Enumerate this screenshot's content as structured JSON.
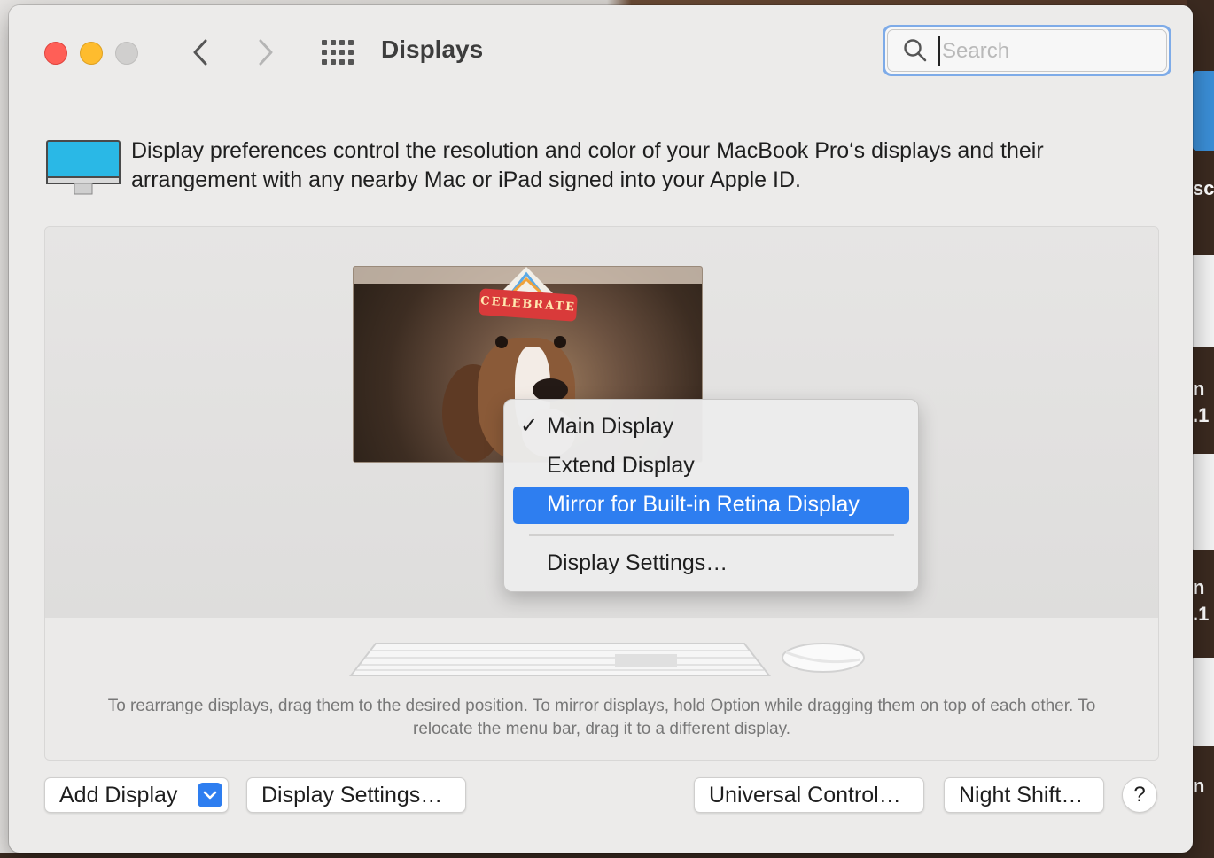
{
  "window": {
    "title": "Displays"
  },
  "toolbar": {
    "back_icon": "chevron-left",
    "forward_icon": "chevron-right",
    "show_all_icon": "grid-dots",
    "search_placeholder": "Search",
    "search_value": ""
  },
  "intro": {
    "text": "Display preferences control the resolution and color of your MacBook Pro‘s displays and their arrangement with any nearby Mac or iPad signed into your Apple ID.",
    "icon": "display-icon",
    "icon_color": "#2ab8e6"
  },
  "arrangement": {
    "hat_text": "CELEBRATE",
    "hint": "To rearrange displays, drag them to the desired position. To mirror displays, hold Option while dragging them on top of each other. To relocate the menu bar, drag it to a different display."
  },
  "context_menu": {
    "items": [
      {
        "label": "Main Display",
        "checked": true,
        "highlighted": false
      },
      {
        "label": "Extend Display",
        "checked": false,
        "highlighted": false
      },
      {
        "label": "Mirror for Built-in Retina Display",
        "checked": false,
        "highlighted": true
      },
      {
        "label": "Display Settings…",
        "checked": false,
        "highlighted": false
      }
    ],
    "check_glyph": "✓",
    "highlight_color": "#2e7ef0"
  },
  "buttons": {
    "add_display": "Add Display",
    "display_settings": "Display Settings…",
    "universal_control": "Universal Control…",
    "night_shift": "Night Shift…",
    "help": "?"
  },
  "desktop": {
    "fragments": [
      "sc",
      "n",
      ".1",
      "n",
      ".1",
      "n"
    ]
  }
}
